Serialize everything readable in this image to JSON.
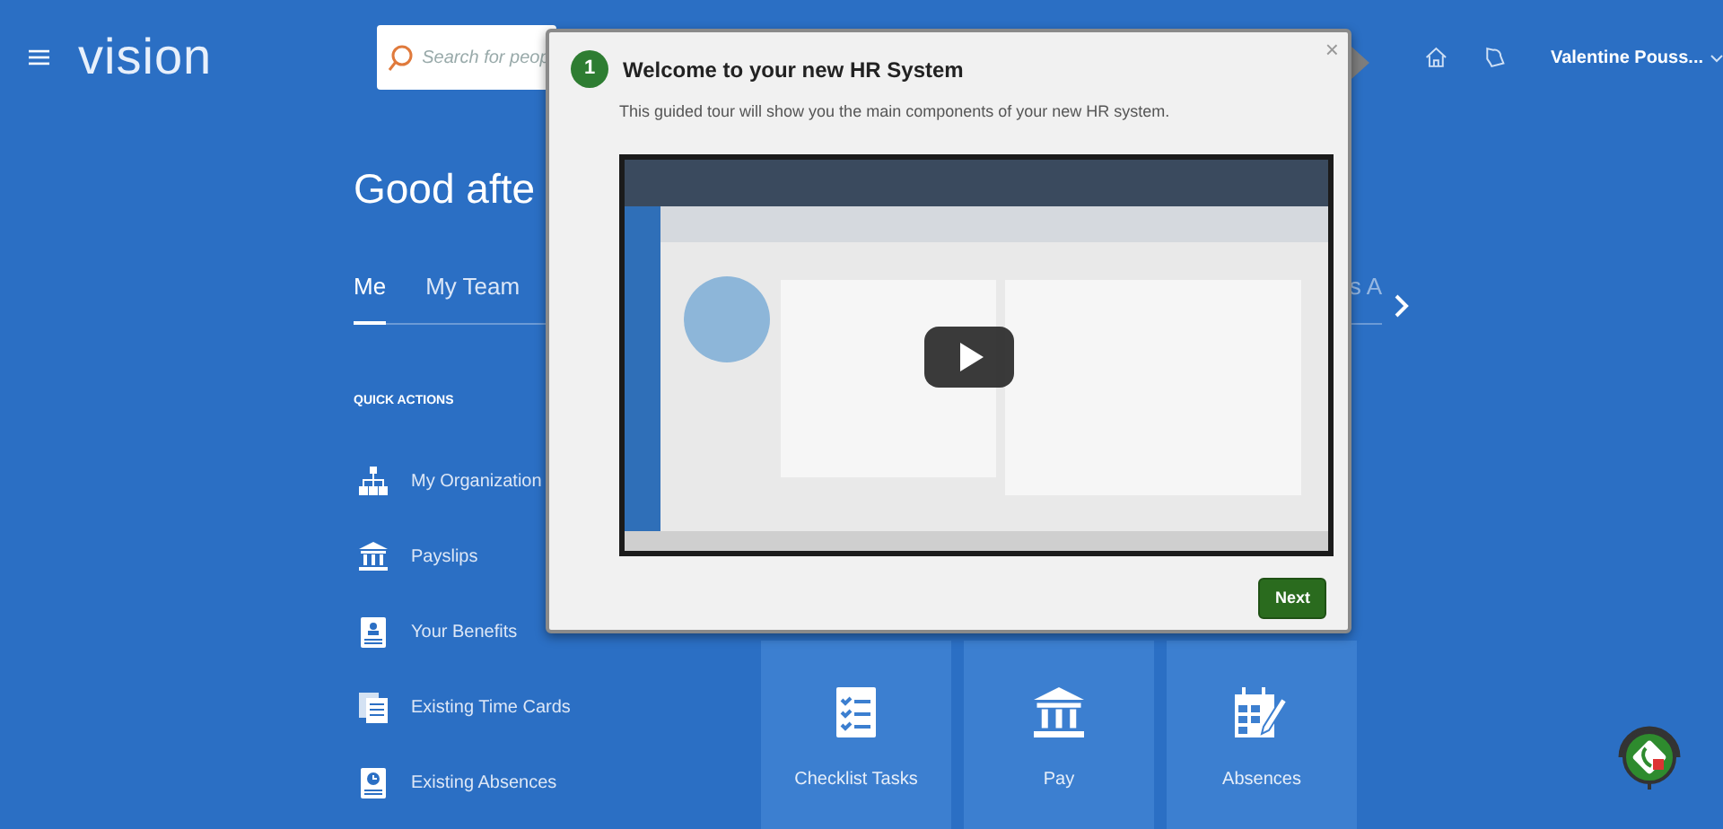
{
  "header": {
    "brand": "vision",
    "search": {
      "placeholder": "Search for peop"
    },
    "user": "Valentine Pouss..."
  },
  "greeting": "Good afte",
  "tabs": [
    {
      "label": "Me",
      "selected": true
    },
    {
      "label": "My Team",
      "selected": false
    },
    {
      "label": "s A",
      "selected": false
    }
  ],
  "quick_actions": {
    "title": "QUICK ACTIONS",
    "items": [
      {
        "label": "My Organization",
        "kind": "org"
      },
      {
        "label": "Payslips",
        "kind": "bank"
      },
      {
        "label": "Your Benefits",
        "kind": "badge"
      },
      {
        "label": "Existing Time Cards",
        "kind": "cards"
      },
      {
        "label": "Existing Absences",
        "kind": "clock"
      }
    ]
  },
  "tiles": [
    {
      "label": "Checklist Tasks",
      "kind": "checklist"
    },
    {
      "label": "Pay",
      "kind": "bank"
    },
    {
      "label": "Absences",
      "kind": "calendar"
    }
  ],
  "tour": {
    "step": "1",
    "title": "Welcome to your new HR System",
    "text": "This guided tour will show you the main components of your new HR system.",
    "close": "×",
    "buttons": [
      "Next"
    ]
  }
}
